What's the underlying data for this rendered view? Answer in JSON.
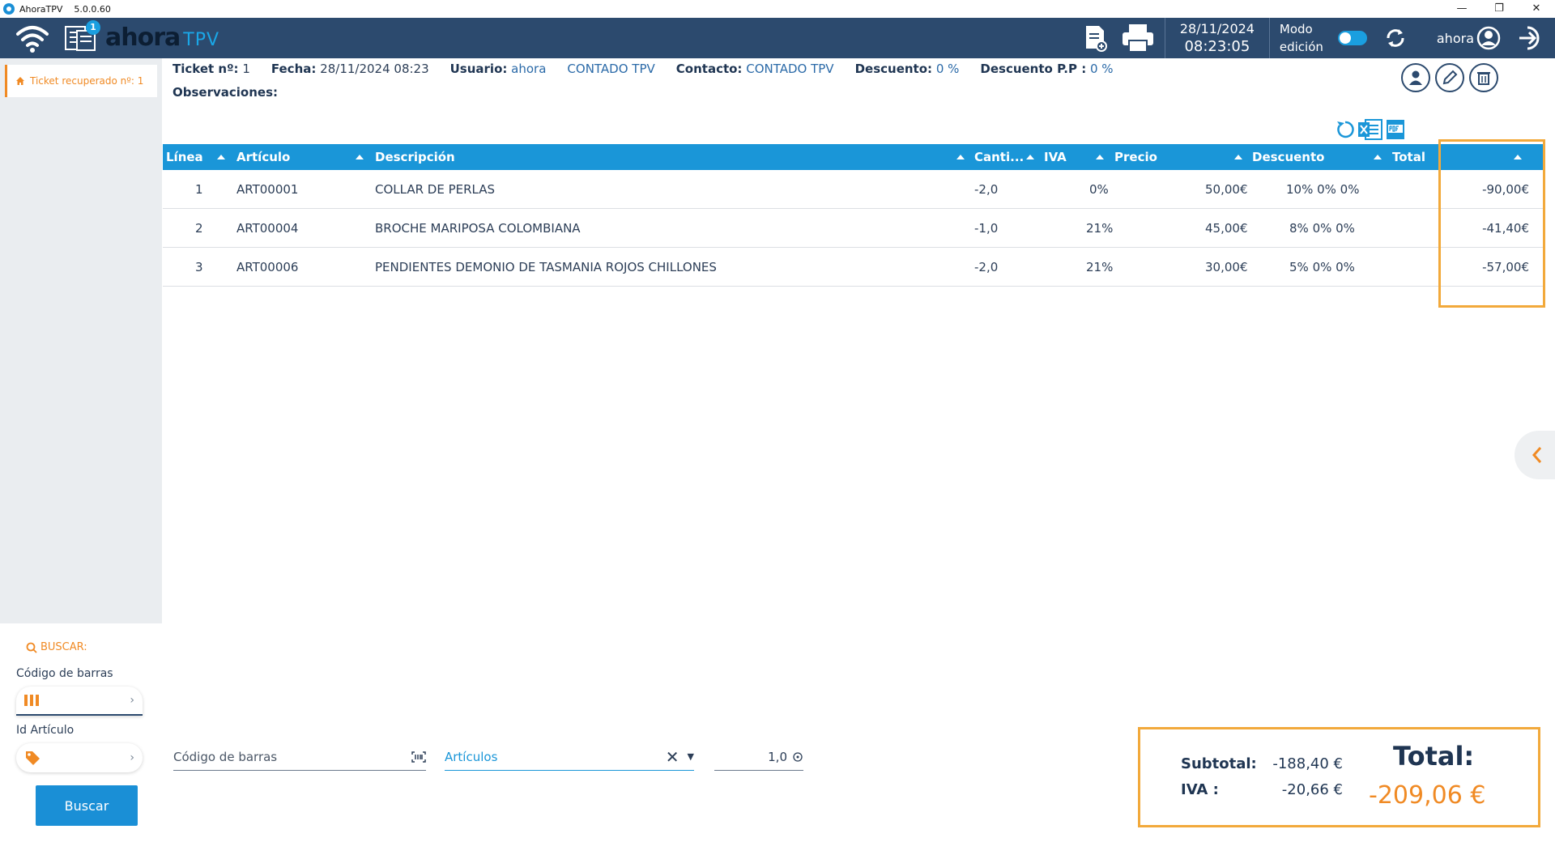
{
  "window": {
    "title": "AhoraTPV",
    "version": "5.0.0.60",
    "min": "—",
    "restore": "❐",
    "close": "✕"
  },
  "header": {
    "badge": "1",
    "logo": "ahora",
    "logo_sub": "TPV",
    "date": "28/11/2024",
    "time": "08:23:05",
    "modo": "Modo",
    "edicion": "edición",
    "user": "ahora"
  },
  "sidebar": {
    "ticket_tab": "Ticket recuperado nº: 1",
    "buscar": "BUSCAR:",
    "barcode_label": "Código de barras",
    "id_label": "Id Artículo",
    "button": "Buscar"
  },
  "info": {
    "ticket_label": "Ticket nº:",
    "ticket_value": "1",
    "fecha_label": "Fecha:",
    "fecha_value": "28/11/2024 08:23",
    "usuario_label": "Usuario:",
    "usuario_value": "ahora",
    "cliente": "CONTADO TPV",
    "contacto_label": "Contacto:",
    "contacto_value": "CONTADO TPV",
    "descuento_label": "Descuento:",
    "descuento_value": "0 %",
    "descuentopp_label": "Descuento P.P :",
    "descuentopp_value": "0 %",
    "observaciones": "Observaciones:"
  },
  "table": {
    "headers": [
      "Línea",
      "Artículo",
      "Descripción",
      "Canti...",
      "IVA",
      "Precio",
      "Descuento",
      "Total"
    ],
    "rows": [
      {
        "linea": "1",
        "articulo": "ART00001",
        "descripcion": "COLLAR DE PERLAS",
        "cantidad": "-2,0",
        "iva": "0%",
        "precio": "50,00€",
        "descuento": "10% 0% 0%",
        "total": "-90,00€"
      },
      {
        "linea": "2",
        "articulo": "ART00004",
        "descripcion": "BROCHE MARIPOSA COLOMBIANA",
        "cantidad": "-1,0",
        "iva": "21%",
        "precio": "45,00€",
        "descuento": "8% 0% 0%",
        "total": "-41,40€"
      },
      {
        "linea": "3",
        "articulo": "ART00006",
        "descripcion": "PENDIENTES DEMONIO DE TASMANIA ROJOS CHILLONES",
        "cantidad": "-2,0",
        "iva": "21%",
        "precio": "30,00€",
        "descuento": "5% 0% 0%",
        "total": "-57,00€"
      }
    ]
  },
  "entry": {
    "barcode_placeholder": "Código de barras",
    "articulos": "Artículos",
    "qty": "1,0"
  },
  "totals": {
    "subtotal_label": "Subtotal:",
    "subtotal_value": "-188,40 €",
    "iva_label": "IVA :",
    "iva_value": "-20,66 €",
    "total_label": "Total:",
    "total_value": "-209,06 €"
  },
  "colors": {
    "header": "#2c4a6e",
    "accent": "#1a96d8",
    "orange": "#f08a24",
    "highlight": "#f2a93b"
  }
}
